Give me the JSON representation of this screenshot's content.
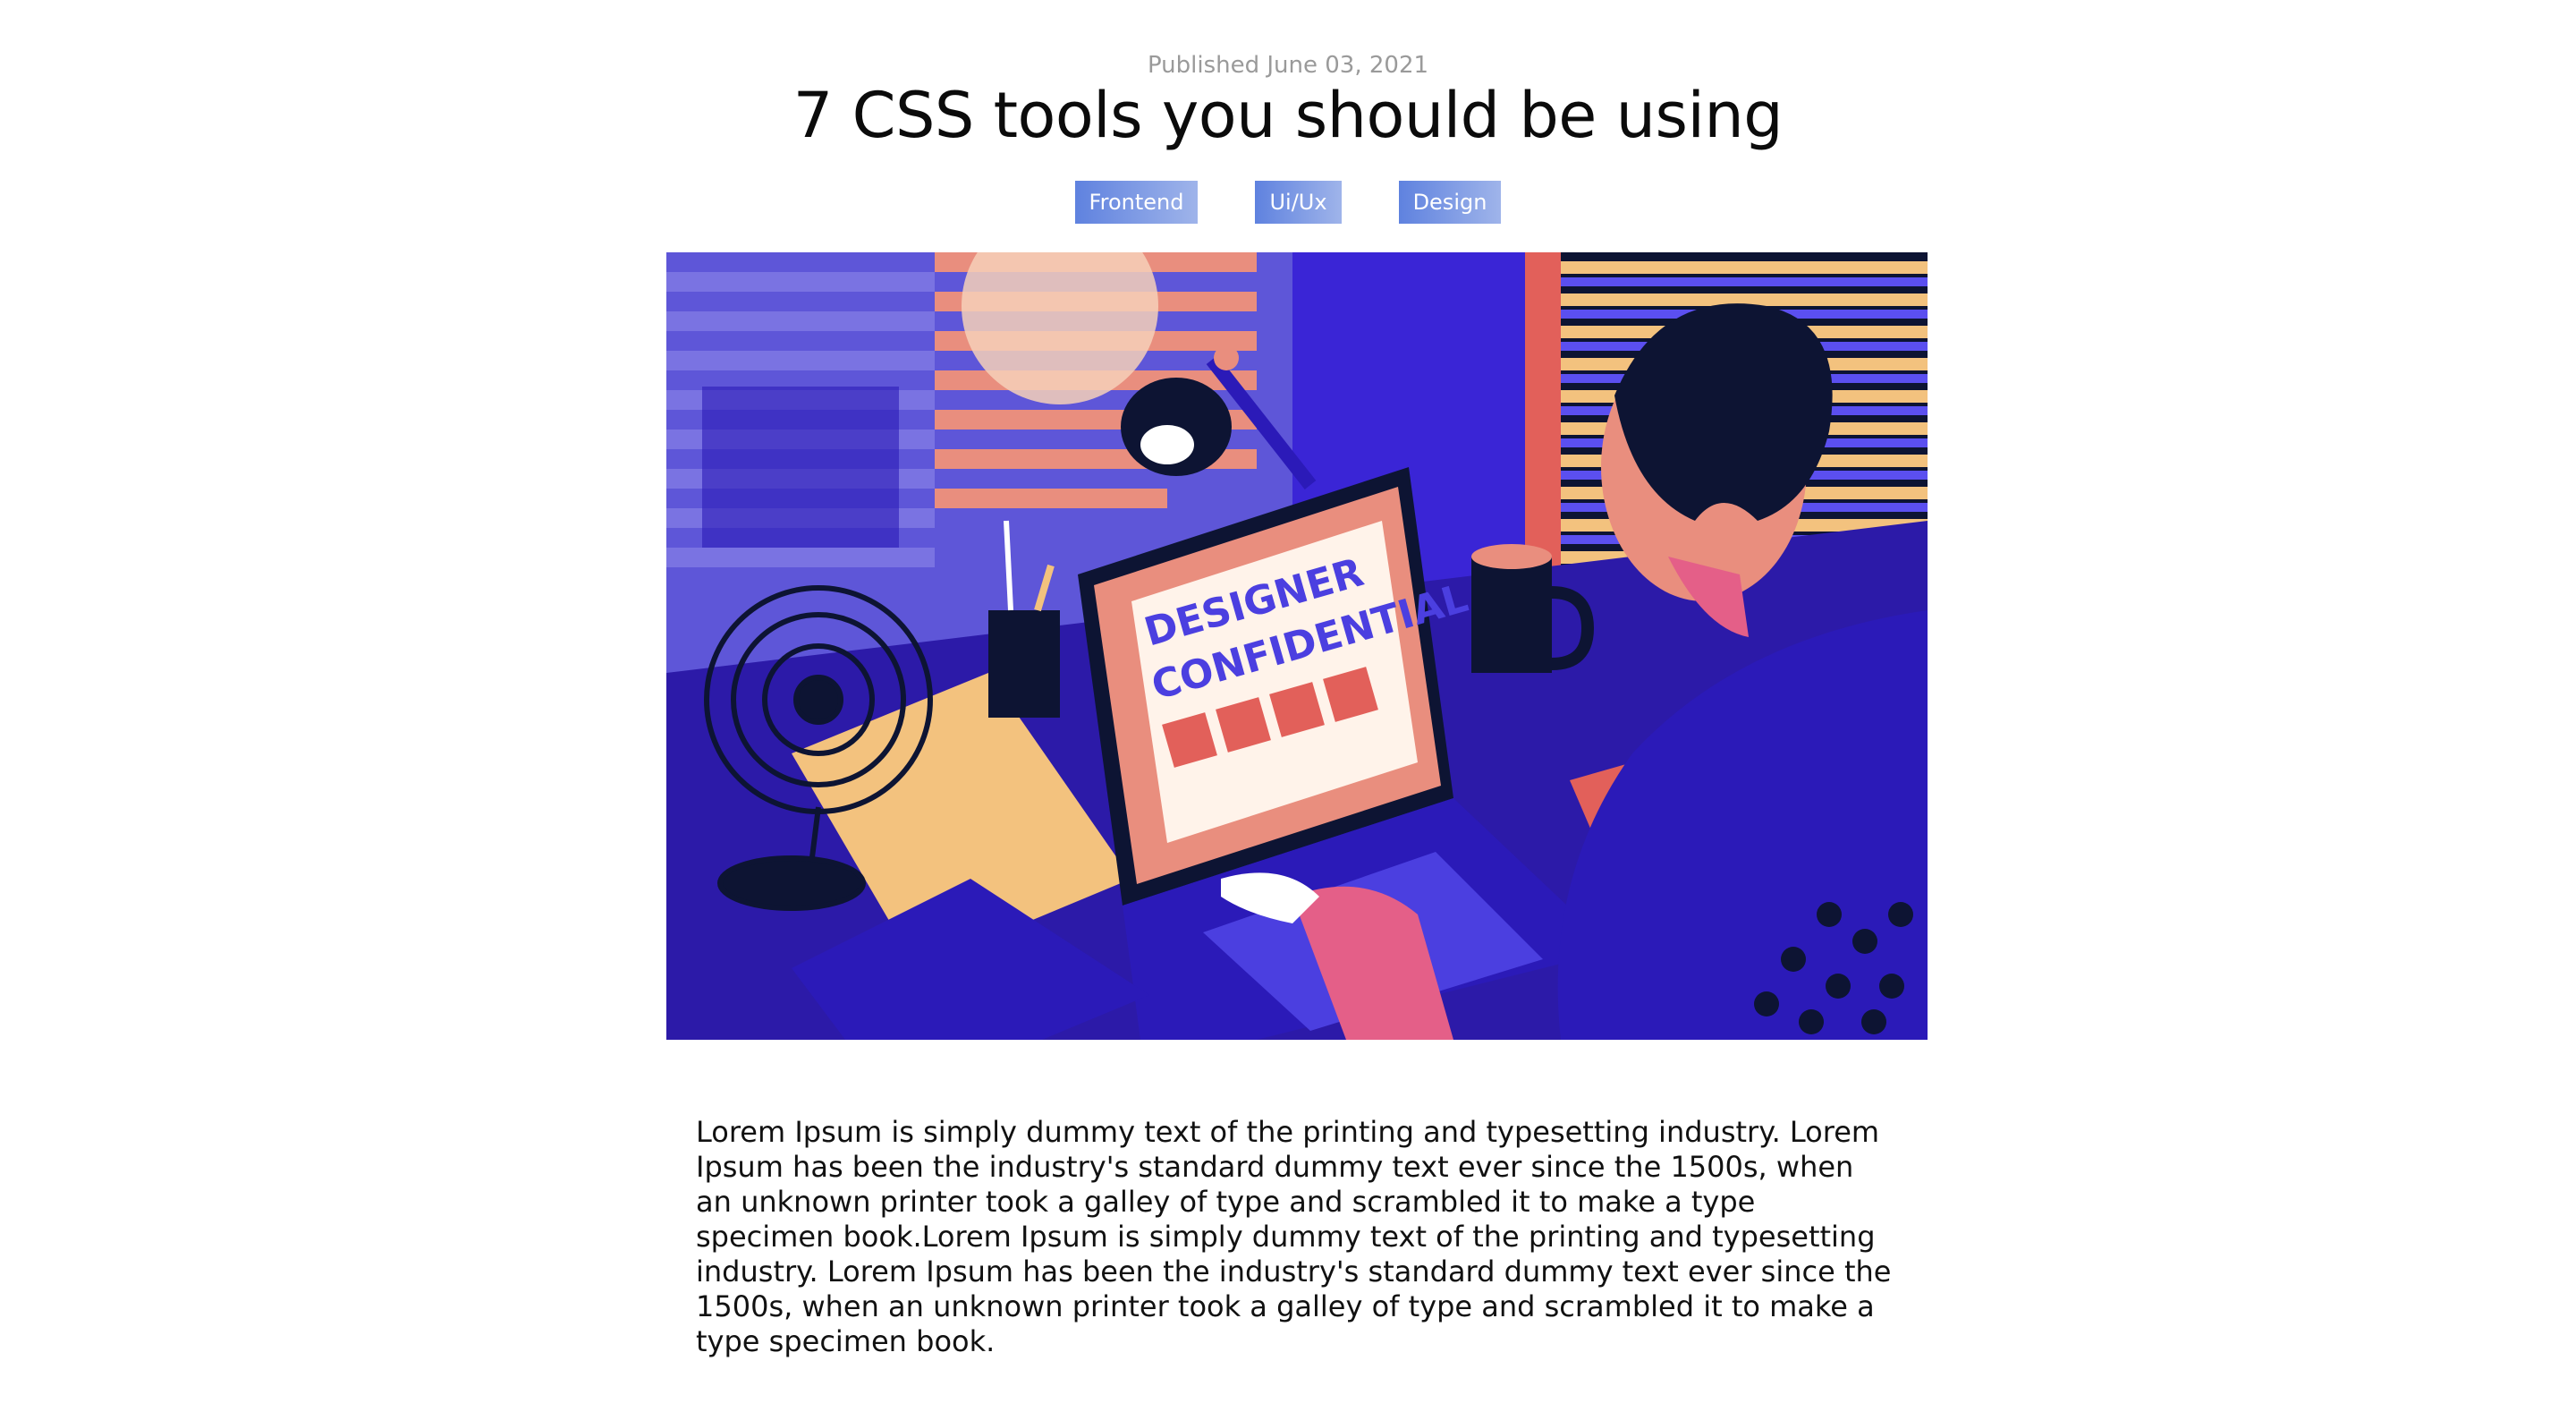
{
  "article": {
    "published": "Published June 03, 2021",
    "title": "7 CSS tools you should be using",
    "tags": [
      "Frontend",
      "Ui/Ux",
      "Design"
    ],
    "hero_screen_text": [
      "DESIGNER",
      "CONFIDENTIAL"
    ],
    "body": "Lorem Ipsum is simply dummy text of the printing and typesetting industry. Lorem Ipsum has been the industry's standard dummy text ever since the 1500s, when an unknown printer took a galley of type and scrambled it to make a type specimen book.Lorem Ipsum is simply dummy text of the printing and typesetting industry. Lorem Ipsum has been the industry's standard dummy text ever since the 1500s, when an unknown printer took a galley of type and scrambled it to make a type specimen book."
  },
  "colors": {
    "tag_start": "#5f82df",
    "tag_end": "#9fb4ea",
    "illustration_primary": "#3a25d6",
    "illustration_accent": "#e9897c"
  }
}
